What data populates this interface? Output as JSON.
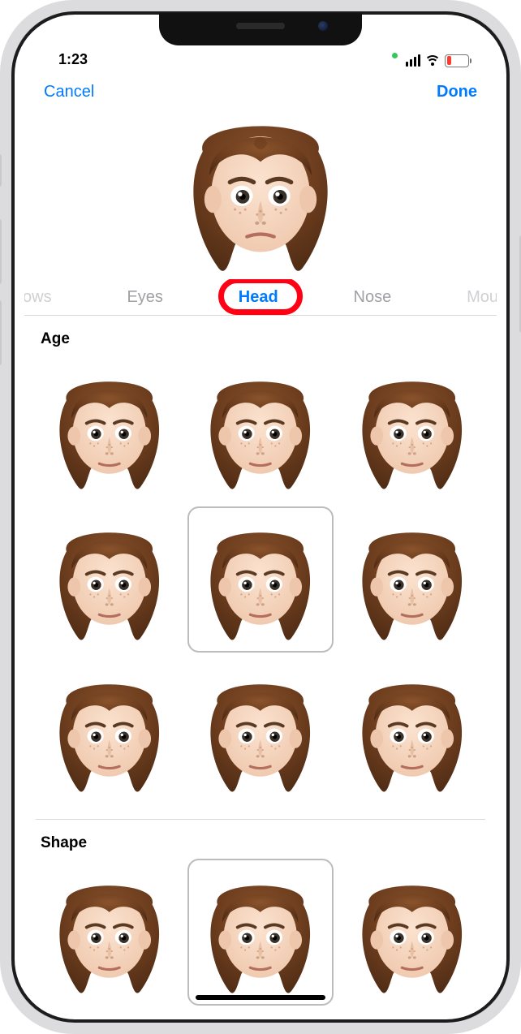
{
  "status": {
    "time": "1:23"
  },
  "nav": {
    "cancel": "Cancel",
    "done": "Done"
  },
  "tabs": {
    "items": [
      "ows",
      "Eyes",
      "Head",
      "Nose",
      "Mou"
    ],
    "active_index": 2,
    "highlighted_label": "Head"
  },
  "sections": [
    {
      "title": "Age",
      "count": 9,
      "selected_index": 4
    },
    {
      "title": "Shape",
      "count": 3,
      "selected_index": 1
    }
  ],
  "colors": {
    "ios_blue": "#007aff",
    "highlight_red": "#ff0015",
    "hair": "#4b2a14",
    "skin": "#f6d6bf"
  },
  "memoji": {
    "description": "female face, long brown wavy hair, fair skin with freckles, brown eyes"
  }
}
